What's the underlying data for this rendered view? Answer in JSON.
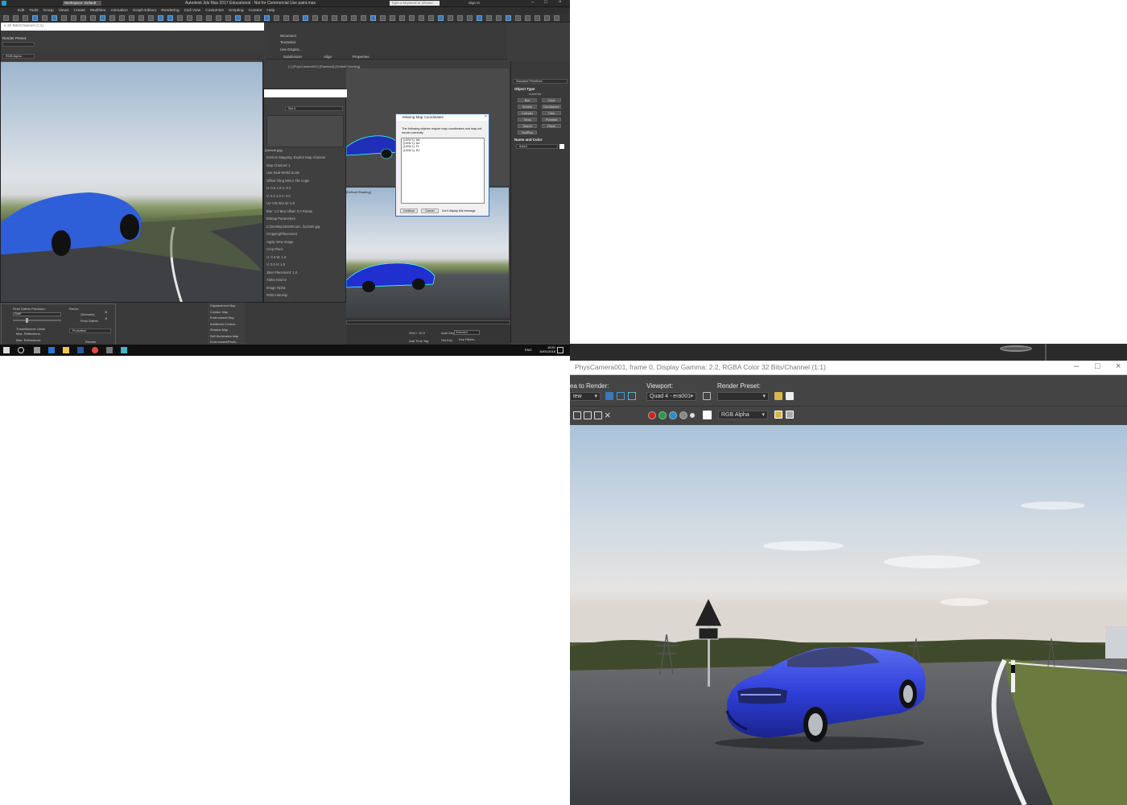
{
  "left_screen": {
    "title": "Autodesk 3ds Max 2017 Educational - Not for Commercial Use   paint.max",
    "workspace": "Workspace: Default",
    "search_placeholder": "Type a keyword or phrase",
    "sign_in": "Sign In",
    "menu": [
      "Edit",
      "Tools",
      "Group",
      "Views",
      "Create",
      "Modifiers",
      "Animation",
      "Graph Editors",
      "Rendering",
      "Civil View",
      "Customize",
      "Scripting",
      "Content",
      "Help"
    ],
    "ribbon": {
      "items": [
        "Wconnect",
        "TexSelect",
        "Use Displac..."
      ],
      "groups": [
        "Subdivision",
        "Align",
        "Properties"
      ]
    },
    "render_frame_small": {
      "title": "e 32 Bits/Channel (1:1)",
      "render_preset_label": "Render Preset:",
      "channel": "RGB Alpha"
    },
    "viewport_labels": [
      "[+] [PhysCamera001] [Standard] [Default Shading]",
      "[Default Shading]"
    ],
    "material_editor": {
      "slot": "Slot #",
      "bitmap": "(lachole.jpg)",
      "rows": [
        "Environ   Mapping:   Explicit Map Channel",
        "Map Channel: 1",
        "Use Real-World Scale",
        "Offset   Tiling   Mirror Tile   Angle",
        "U: 0.0   1.0   U: 0.0",
        "V: 0.0   1.0   V: 0.0",
        "UV  VW  WU   W: 0.0",
        "Blur: 1.0   Blur offset: 0.0   Rotate",
        "Bitmap Parameters",
        "C:\\Desktop\\3DMK\\car\\...\\lachole.jpg",
        "Cropping/Placement",
        "Apply   View Image",
        "Crop   Place",
        "U: 0.0   W: 1.0",
        "V: 0.0   H: 1.0",
        "Jitter Placement: 1.0",
        "Alpha Source",
        "Image Alpha",
        "RGB Intensity",
        "None (Opaque)",
        "Premultiplied Alpha",
        "Time",
        "Output"
      ]
    },
    "command_panel": {
      "dropdown": "Standard Primitives",
      "object_type": "Object Type",
      "autogrid": "AutoGrid",
      "buttons": [
        "Box",
        "Cone",
        "Sphere",
        "GeoSphere",
        "Cylinder",
        "Tube",
        "Torus",
        "Pyramid",
        "Teapot",
        "Plane",
        "TextPlus"
      ],
      "name_and_color": "Name and Color",
      "name_value": "lines4"
    },
    "dialog": {
      "title": "Missing Map Coordinates",
      "message": "The following objects require map coordinates and may not render correctly:",
      "items": [
        "(UVW 1): fd1",
        "(UVW 1): fs1",
        "(UVW 1): FL",
        "(UVW 1): R1"
      ],
      "continue": "Continue",
      "cancel": "Cancel",
      "dont_display": "Don't display this message"
    },
    "bottom_panel": {
      "final_gather": "Final Gather Precision:",
      "draft": "Draft",
      "reuse": "Reuse",
      "geometry": "Geometry",
      "final_gather2": "Final Gather",
      "trace_limits": "Trace/Bounce Limits",
      "max_reflections": "Max. Reflections:",
      "max_refractions": "Max. Refractions:",
      "production": "Production",
      "render": "Render",
      "maps": [
        "Displacement Map",
        "Contour Map",
        "Environment Map",
        "Additional Contour...",
        "Shadow Map",
        "Self Illumination Map",
        "Environment/Photo..."
      ]
    },
    "timeline": {
      "grid": "Grid = 10.0",
      "auto_key": "Auto Key",
      "set_key": "Set Key",
      "selected": "Selected",
      "key_filters": "Key Filters...",
      "add_time_tag": "Add Time Tag"
    },
    "taskbar_clock": {
      "time": "18:51",
      "date": "10/01/2018",
      "lang": "ENG"
    }
  },
  "right_window": {
    "title": "PhysCamera001, frame 0, Display Gamma: 2.2, RGBA Color 32 Bits/Channel (1:1)",
    "area_to_render_label": "ea to Render:",
    "area_value": "iew",
    "viewport_label": "Viewport:",
    "viewport_value": "Quad 4 - era001",
    "render_preset_label": "Render Preset:",
    "render_preset_value": "",
    "channel": "RGB Alpha",
    "colors": {
      "red": "#d32020",
      "green": "#20a040",
      "blue": "#2090d0",
      "car": "#2f3fd8"
    }
  }
}
